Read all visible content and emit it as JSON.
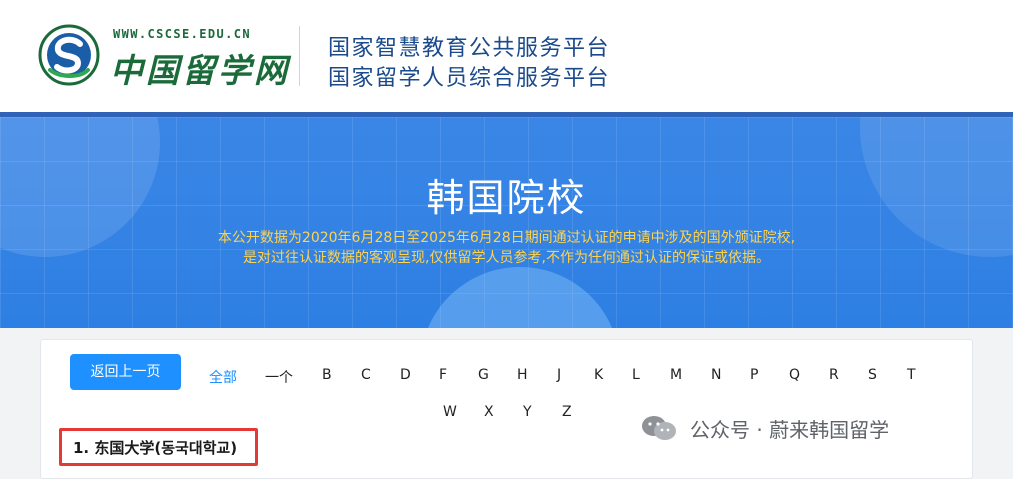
{
  "header": {
    "logo_url": "WWW.CSCSE.EDU.CN",
    "logo_name": "中国留学网",
    "platform_line1": "国家智慧教育公共服务平台",
    "platform_line2": "国家留学人员综合服务平台"
  },
  "banner": {
    "title": "韩国院校",
    "subtitle_line1": "本公开数据为2020年6月28日至2025年6月28日期间通过认证的申请中涉及的国外颁证院校,",
    "subtitle_line2": "是对过往认证数据的客观呈现,仅供留学人员参考,不作为任何通过认证的保证或依据。"
  },
  "filter": {
    "back_label": "返回上一页",
    "letters": [
      "全部",
      "一个",
      "B",
      "C",
      "D",
      "F",
      "G",
      "H",
      "J",
      "K",
      "L",
      "M",
      "N",
      "P",
      "Q",
      "R",
      "S",
      "T",
      "W",
      "X",
      "Y",
      "Z"
    ],
    "active": "全部"
  },
  "list": {
    "first_item": "1. 东国大学(동국대학교)"
  },
  "watermark": {
    "text": "公众号 · 蔚来韩国留学"
  },
  "colors": {
    "accent": "#1e90ff",
    "banner": "#3a86e6",
    "subtitle": "#ffd34d",
    "highlight": "#e53935"
  }
}
